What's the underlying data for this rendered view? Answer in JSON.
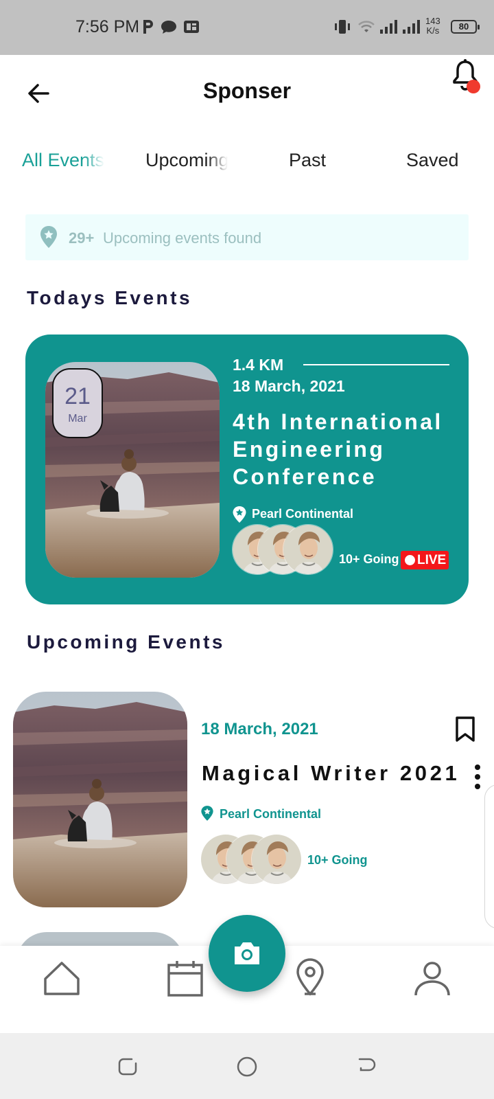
{
  "status_bar": {
    "time": "7:56 PM",
    "speed_value": "143",
    "speed_unit": "K/s",
    "battery": "80",
    "icons": [
      "parking-icon",
      "chat-bubble-icon",
      "news-icon",
      "vibrate-icon",
      "wifi-icon",
      "signal-icon",
      "signal-icon"
    ]
  },
  "header": {
    "title": "Sponser",
    "back_icon": "arrow-left-icon",
    "notification_icon": "bell-icon",
    "notification_dot_color": "#f03a2e"
  },
  "tabs": [
    {
      "label": "All Events",
      "active": true
    },
    {
      "label": "Upcoming",
      "active": false
    },
    {
      "label": "Past",
      "active": false
    },
    {
      "label": "Saved",
      "active": false
    }
  ],
  "found_banner": {
    "count": "29+",
    "text": "Upcoming events found"
  },
  "sections": {
    "today_title": "Todays Events",
    "upcoming_title": "Upcoming Events"
  },
  "today_event": {
    "badge_day": "21",
    "badge_month": "Mar",
    "distance": "1.4 KM",
    "date": "18 March, 2021",
    "title": "4th International Engineering Conference",
    "venue": "Pearl Continental",
    "going": "10+ Going",
    "live_label": "LIVE"
  },
  "upcoming_event": {
    "date": "18 March, 2021",
    "title": "Magical Writer 2021",
    "venue": "Pearl Continental",
    "going": "10+ Going"
  },
  "bottom_nav": {
    "items": [
      "home-icon",
      "calendar-icon",
      "camera-icon",
      "map-pin-icon",
      "user-icon"
    ]
  },
  "colors": {
    "accent": "#10948f",
    "tab_active": "#19a097",
    "heading": "#1c1a3d",
    "live": "#f3171a",
    "banner_bg": "#eefdfd"
  }
}
